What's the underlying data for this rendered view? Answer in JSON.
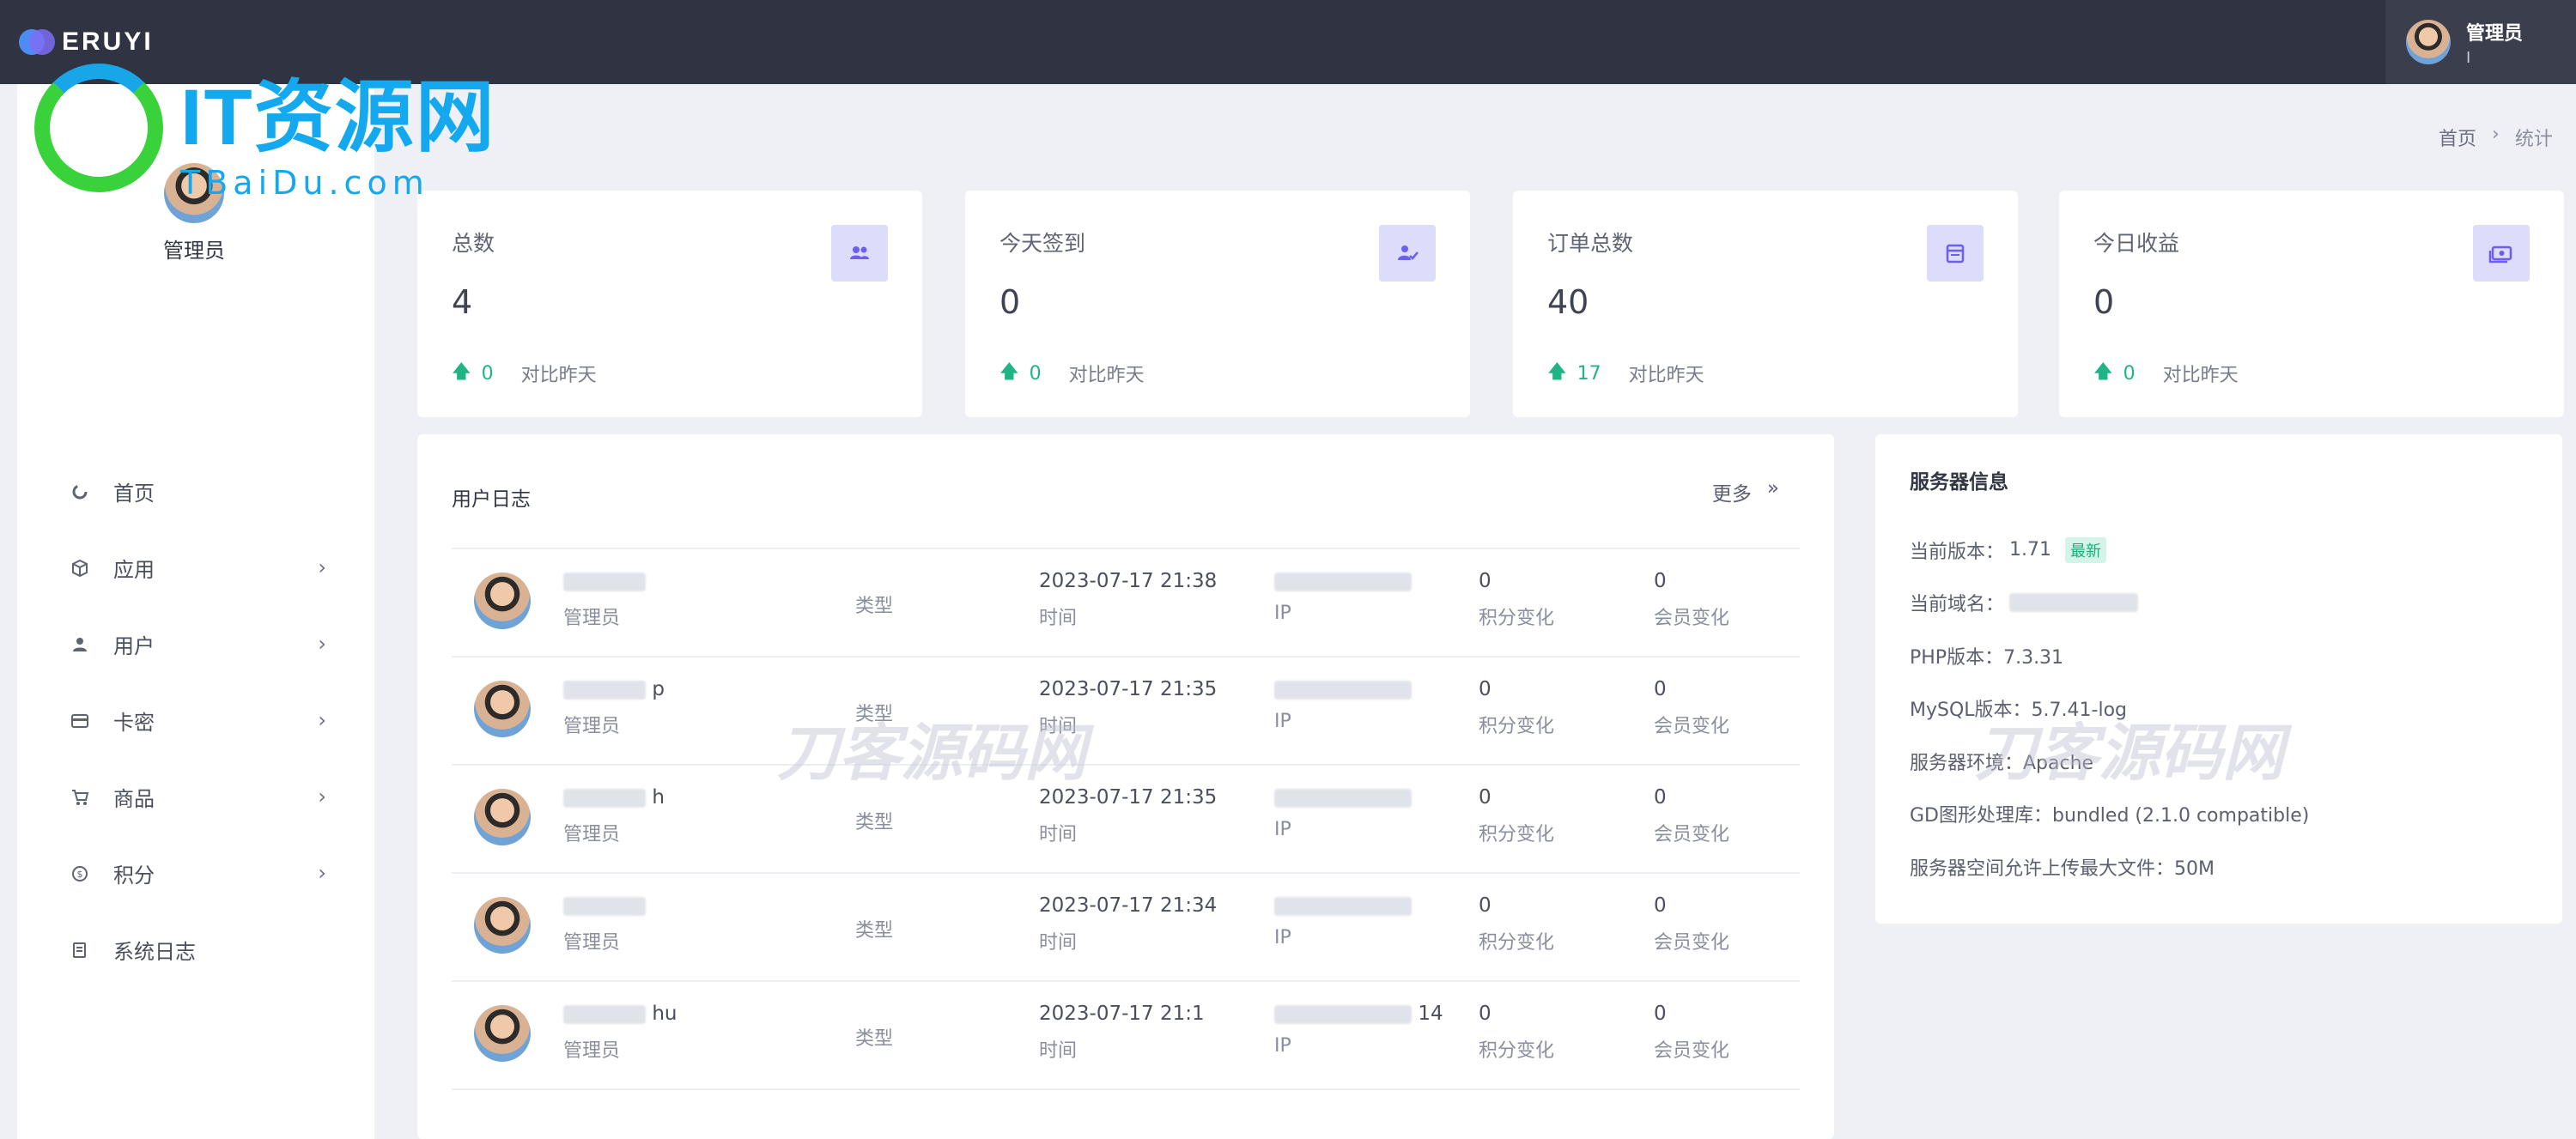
{
  "brand": {
    "name": "ERUYI"
  },
  "header": {
    "user_name": "管理员",
    "user_sub": "I"
  },
  "sidebar": {
    "profile_name": "管理员",
    "items": [
      {
        "label": "首页",
        "icon": "dashboard-icon",
        "has_children": false
      },
      {
        "label": "应用",
        "icon": "cube-icon",
        "has_children": true
      },
      {
        "label": "用户",
        "icon": "user-icon",
        "has_children": true
      },
      {
        "label": "卡密",
        "icon": "card-icon",
        "has_children": true
      },
      {
        "label": "商品",
        "icon": "cart-icon",
        "has_children": true
      },
      {
        "label": "积分",
        "icon": "coin-icon",
        "has_children": true
      },
      {
        "label": "系统日志",
        "icon": "log-icon",
        "has_children": false
      }
    ]
  },
  "breadcrumb": {
    "home": "首页",
    "separator": "›",
    "current": "统计"
  },
  "stats": [
    {
      "title": "总数",
      "value": "4",
      "delta": "0",
      "compare": "对比昨天",
      "icon": "users-icon"
    },
    {
      "title": "今天签到",
      "value": "0",
      "delta": "0",
      "compare": "对比昨天",
      "icon": "checkin-icon"
    },
    {
      "title": "订单总数",
      "value": "40",
      "delta": "17",
      "compare": "对比昨天",
      "icon": "order-icon"
    },
    {
      "title": "今日收益",
      "value": "0",
      "delta": "0",
      "compare": "对比昨天",
      "icon": "money-icon"
    }
  ],
  "log": {
    "title": "用户日志",
    "more_label": "更多",
    "more_icon": "»",
    "labels": {
      "type": "类型",
      "time": "时间",
      "ip": "IP",
      "points": "积分变化",
      "member": "会员变化"
    },
    "rows": [
      {
        "name": "",
        "role": "管理员",
        "time": "2023-07-17 21:38",
        "ip": "",
        "points": "0",
        "member": "0"
      },
      {
        "name": "p",
        "role": "管理员",
        "time": "2023-07-17 21:35",
        "ip": "",
        "points": "0",
        "member": "0"
      },
      {
        "name": "h",
        "role": "管理员",
        "time": "2023-07-17 21:35",
        "ip": "",
        "points": "0",
        "member": "0"
      },
      {
        "name": "",
        "role": "管理员",
        "time": "2023-07-17 21:34",
        "ip": "",
        "points": "0",
        "member": "0"
      },
      {
        "name": "hu",
        "role": "管理员",
        "time": "2023-07-17 21:1",
        "ip": "14",
        "points": "0",
        "member": "0"
      }
    ]
  },
  "server": {
    "title": "服务器信息",
    "version_label": "当前版本：",
    "version": "1.71",
    "version_badge": "最新",
    "domain_label": "当前域名：",
    "php": "PHP版本：7.3.31",
    "mysql": "MySQL版本：5.7.41-log",
    "env": "服务器环境：Apache",
    "gd": "GD图形处理库：bundled (2.1.0 compatible)",
    "upload": "服务器空间允许上传最大文件：50M"
  },
  "watermarks": {
    "logo_main": "IT资源网",
    "logo_sub": "TBaiDu.com",
    "ghost1": "刀客源码网",
    "ghost2": "刀客源码网"
  },
  "colors": {
    "topbar": "#2f3342",
    "accent": "#6a5ff0",
    "up": "#20b386"
  }
}
